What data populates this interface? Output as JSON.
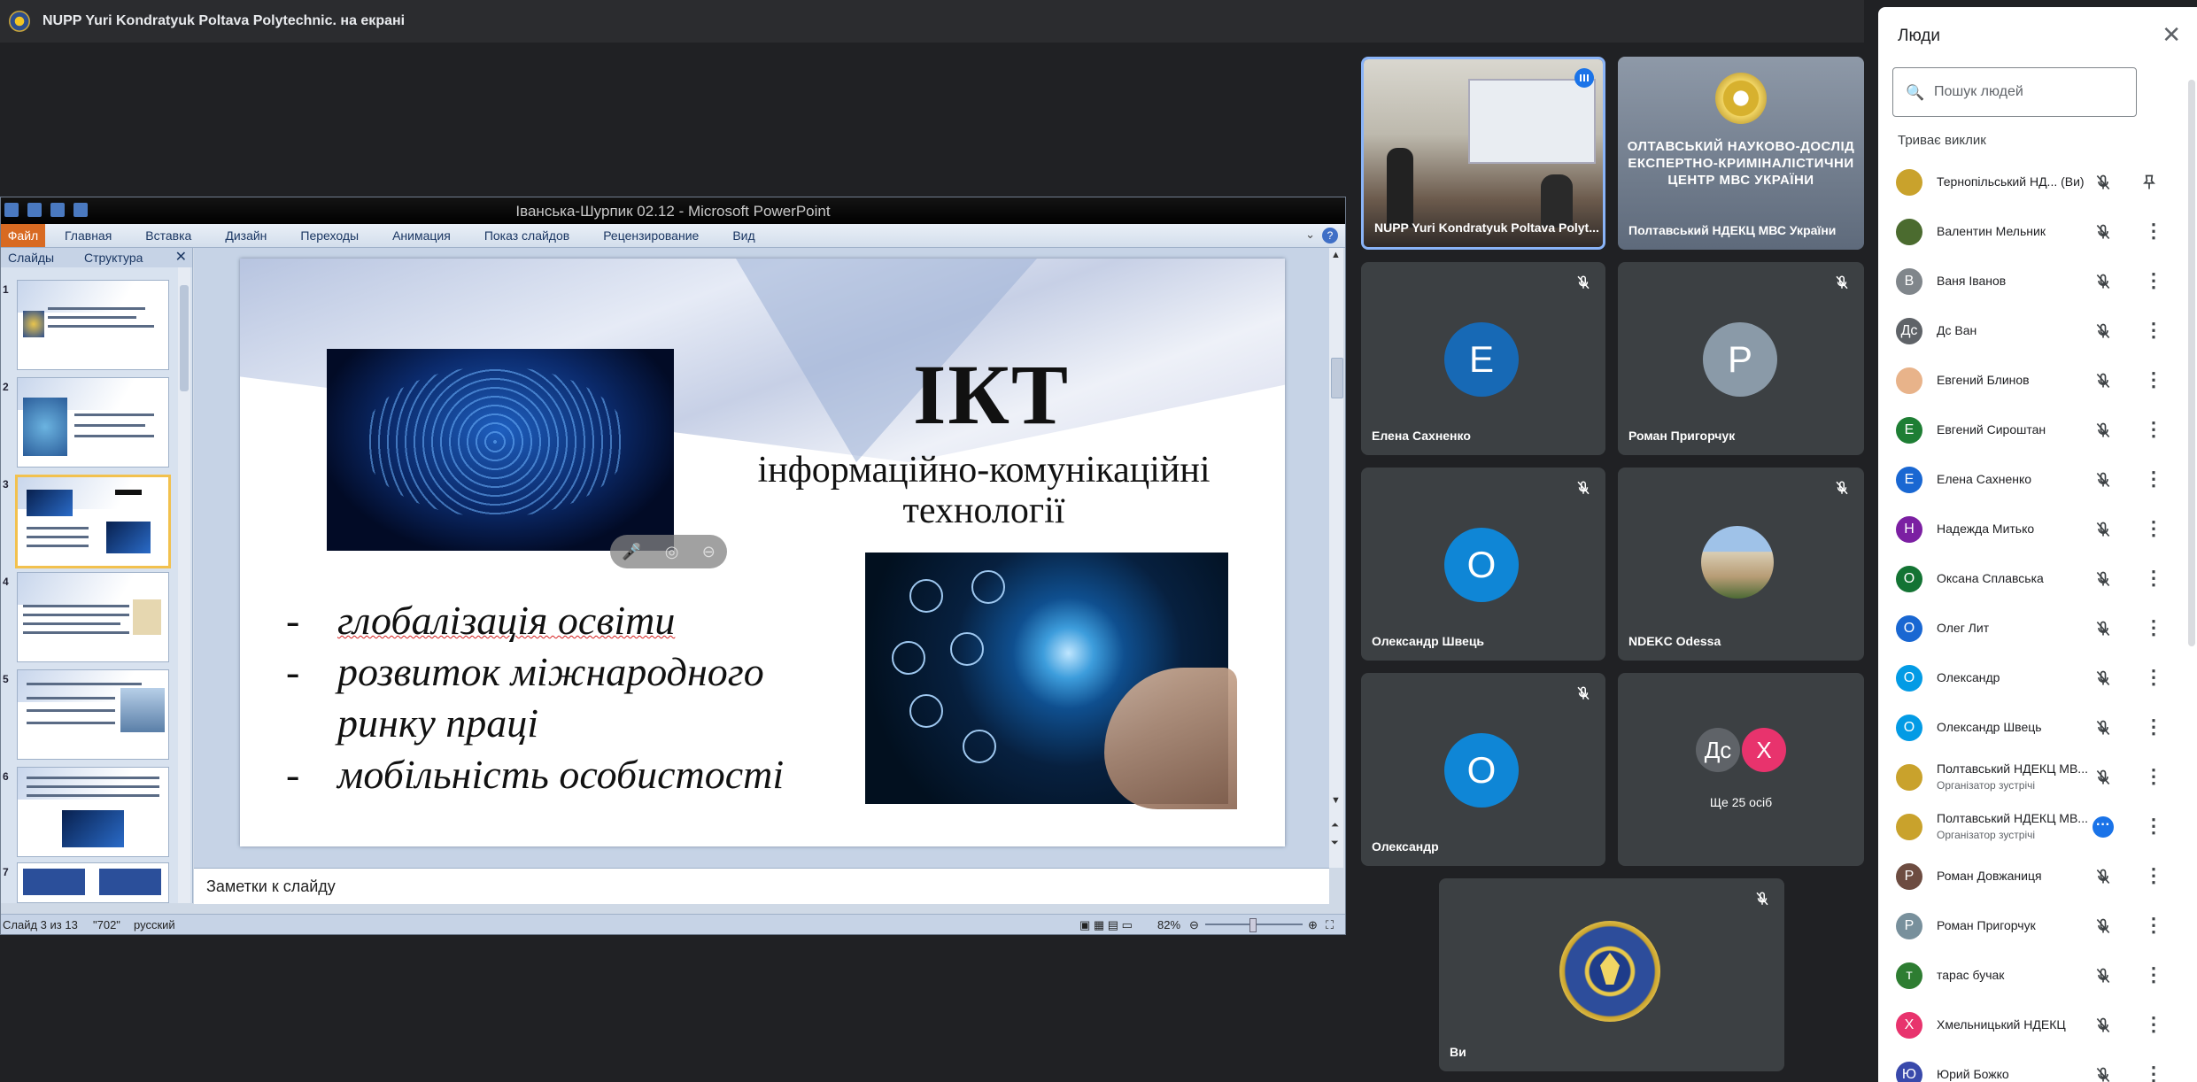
{
  "presentation_bar": {
    "title": "NUPP Yuri Kondratyuk Poltava Polytechnic. на екрані"
  },
  "ppt": {
    "window_title": "Іванська-Шурпик 02.12 - Microsoft PowerPoint",
    "file_tab": "Файл",
    "ribbon_tabs": [
      "Главная",
      "Вставка",
      "Дизайн",
      "Переходы",
      "Анимация",
      "Показ слайдов",
      "Рецензирование",
      "Вид"
    ],
    "pane_tabs": {
      "slides": "Слайды",
      "outline": "Структура"
    },
    "thumbnails": [
      "1",
      "2",
      "3",
      "4",
      "5",
      "6",
      "7"
    ],
    "selected_slide": 3,
    "slide": {
      "title": "ІКТ",
      "subtitle_line1": "інформаційно-комунікаційні",
      "subtitle_line2": "технології",
      "bullet1": "глобалізація освіти",
      "bullet2_a": "розвиток    міжнародного",
      "bullet2_b": "ринку праці",
      "bullet3": "мобільність особистості"
    },
    "notes_placeholder": "Заметки к слайду",
    "status": {
      "slide_info": "Слайд 3 из 13",
      "theme": "\"702\"",
      "language": "русский",
      "zoom": "82%"
    }
  },
  "tiles": {
    "presenter": "NUPP Yuri Kondratyuk Poltava Polyt...",
    "poltava": {
      "name": "Полтавський НДЕКЦ МВС України",
      "wall_text_1": "ОЛТАВСЬКИЙ НАУКОВО-ДОСЛІД",
      "wall_text_2": "ЕКСПЕРТНО-КРИМІНАЛІСТИЧНИ",
      "wall_text_3": "ЦЕНТР МВС УКРАЇНИ"
    },
    "elena": {
      "name": "Елена Сахненко",
      "initial": "E"
    },
    "roman": {
      "name": "Роман Пригорчук",
      "initial": "P"
    },
    "shvets": {
      "name": "Олександр Швець",
      "initial": "O"
    },
    "odessa": {
      "name": "NDEKC Odessa"
    },
    "oleksandr": {
      "name": "Олександр",
      "initial": "O"
    },
    "more": {
      "a": "Дс",
      "b": "X",
      "label": "Ще 25 осіб"
    },
    "you": {
      "name": "Ви"
    }
  },
  "people_panel": {
    "title": "Люди",
    "search_placeholder": "Пошук людей",
    "section": "Триває виклик",
    "participants": [
      {
        "initial": "",
        "name": "Тернопільський НД... (Ви)",
        "color": "#c9a22c",
        "role": ""
      },
      {
        "initial": "",
        "name": "Валентин Мельник",
        "color": "#4b6b2f",
        "role": ""
      },
      {
        "initial": "В",
        "name": "Ваня Іванов",
        "color": "#80868b",
        "role": ""
      },
      {
        "initial": "Дс",
        "name": "Дс Ван",
        "color": "#5f6368",
        "role": ""
      },
      {
        "initial": "",
        "name": "Евгений Блинов",
        "color": "#e8b38a",
        "role": ""
      },
      {
        "initial": "E",
        "name": "Евгений Сироштан",
        "color": "#1e7e34",
        "role": ""
      },
      {
        "initial": "E",
        "name": "Елена Сахненко",
        "color": "#1967d2",
        "role": ""
      },
      {
        "initial": "Н",
        "name": "Надежда Митько",
        "color": "#7b1fa2",
        "role": ""
      },
      {
        "initial": "O",
        "name": "Оксана Сплавська",
        "color": "#137333",
        "role": ""
      },
      {
        "initial": "O",
        "name": "Олег Лит",
        "color": "#1967d2",
        "role": ""
      },
      {
        "initial": "O",
        "name": "Олександр",
        "color": "#039be5",
        "role": ""
      },
      {
        "initial": "O",
        "name": "Олександр Швець",
        "color": "#039be5",
        "role": ""
      },
      {
        "initial": "",
        "name": "Полтавський НДЕКЦ МВ...",
        "color": "#c9a22c",
        "role": "Організатор зустрічі"
      },
      {
        "initial": "",
        "name": "Полтавський НДЕКЦ МВ...",
        "color": "#c9a22c",
        "role": "Організатор зустрічі"
      },
      {
        "initial": "P",
        "name": "Роман Довжаниця",
        "color": "#6d4c41",
        "role": ""
      },
      {
        "initial": "P",
        "name": "Роман Пригорчук",
        "color": "#78909c",
        "role": ""
      },
      {
        "initial": "т",
        "name": "тарас бучак",
        "color": "#2e7d32",
        "role": ""
      },
      {
        "initial": "X",
        "name": "Хмельницький НДЕКЦ",
        "color": "#e8336d",
        "role": ""
      },
      {
        "initial": "Ю",
        "name": "Юрий Божко",
        "color": "#3949ab",
        "role": ""
      }
    ]
  }
}
